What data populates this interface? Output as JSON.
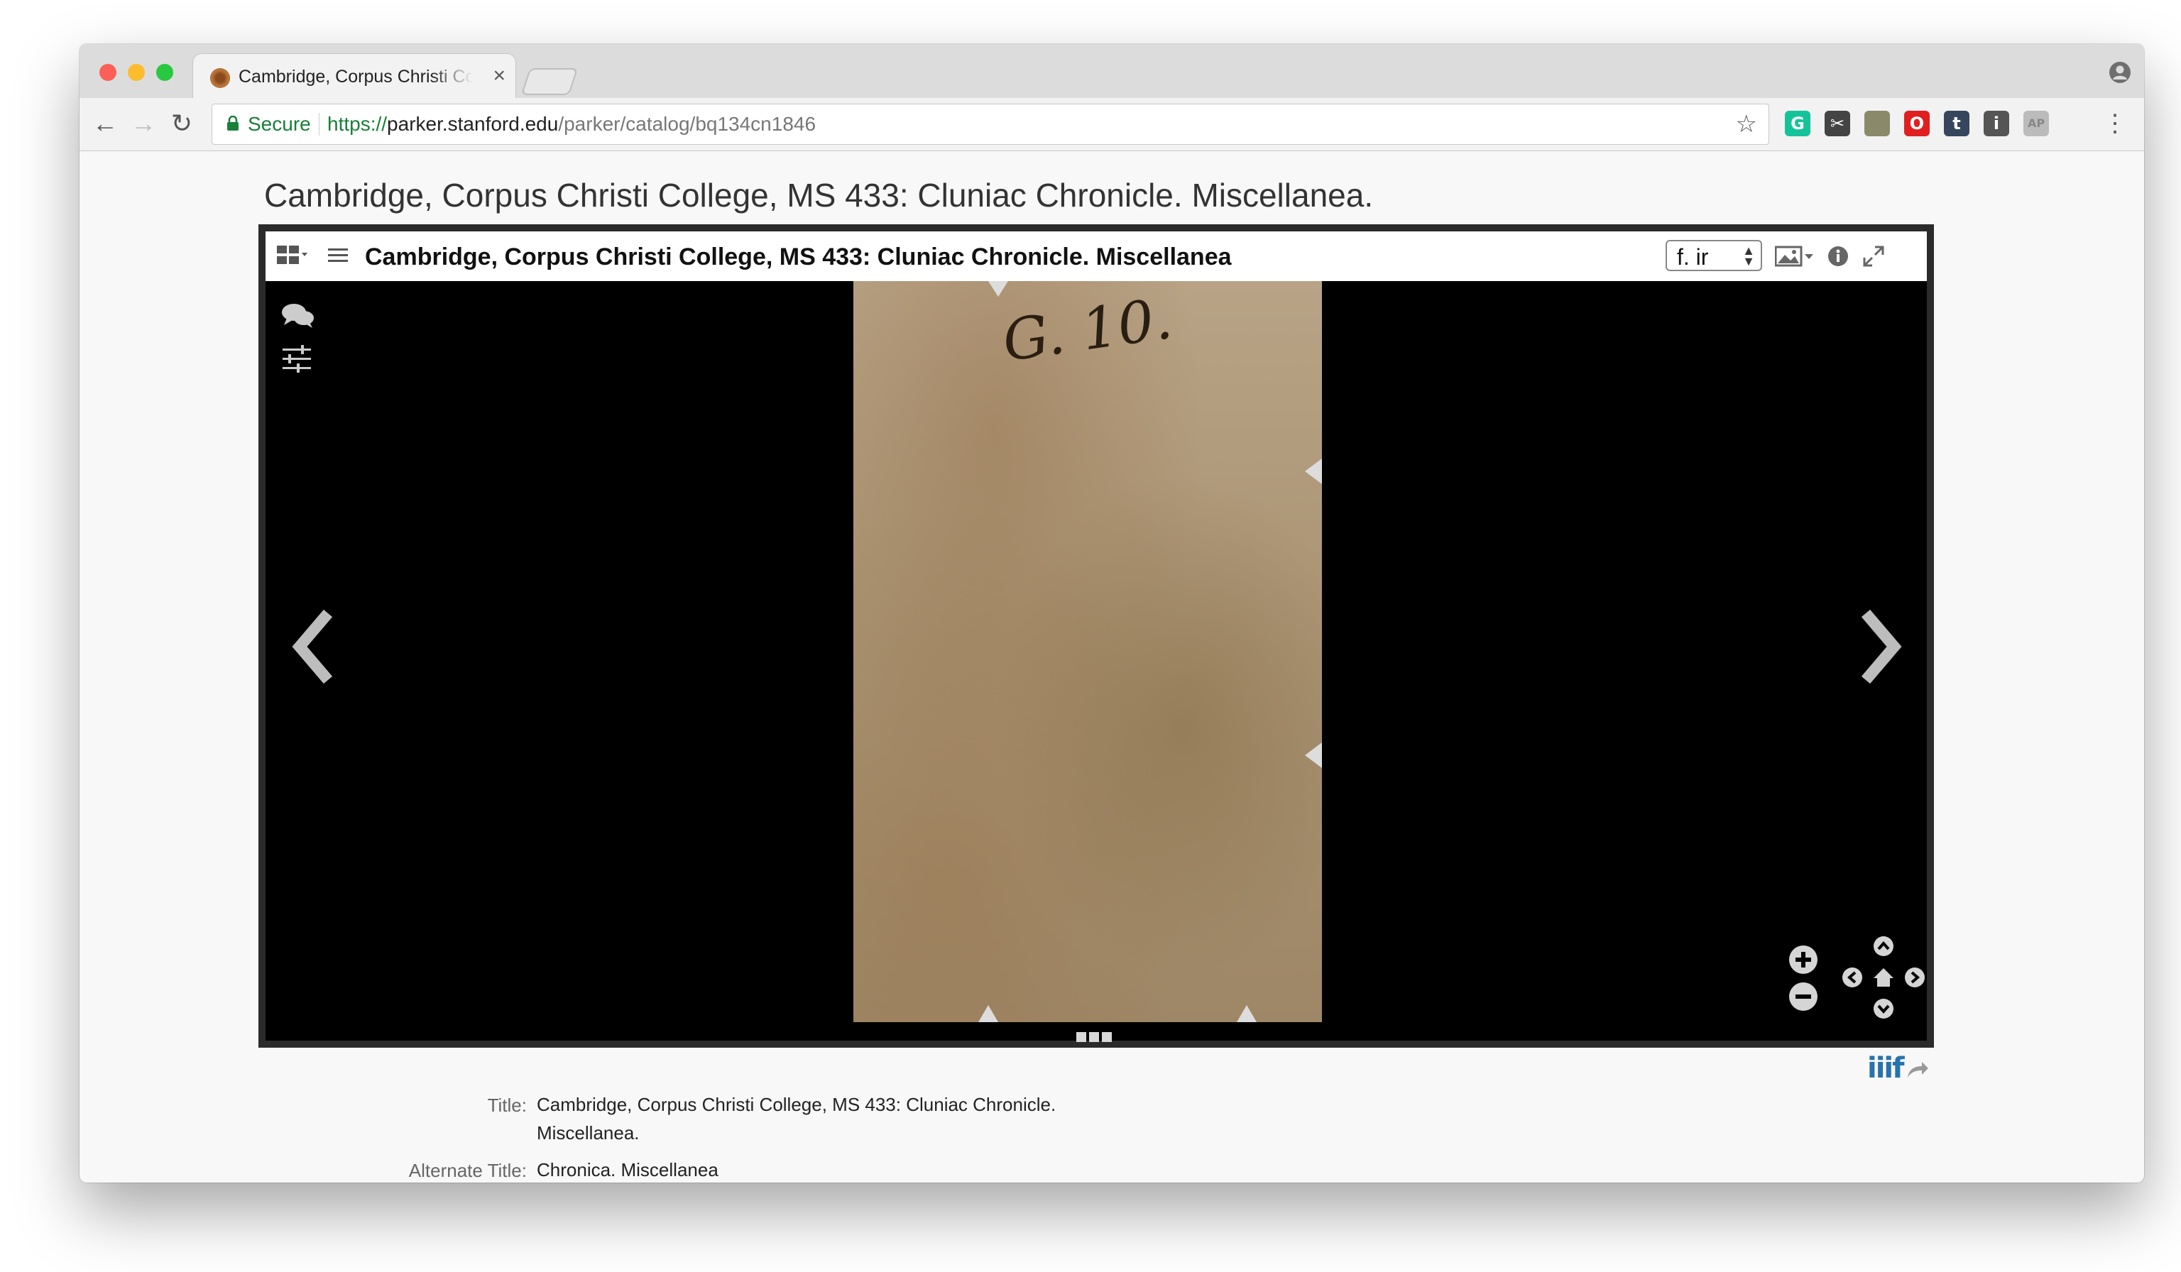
{
  "browser": {
    "tab_title": "Cambridge, Corpus Christi College, MS 433: Cluniac Chronicle. Miscellanea.",
    "tab_close": "×",
    "secure_label": "Secure",
    "url_scheme": "https://",
    "url_host": "parker.stanford.edu",
    "url_path": "/parker/catalog/bq134cn1846",
    "extensions": [
      {
        "icon": "grammarly-icon",
        "color": "#15c39a",
        "glyph": "G"
      },
      {
        "icon": "scissors-icon",
        "color": "#444444",
        "glyph": "✂"
      },
      {
        "icon": "postage-stamp-icon",
        "color": "#8a8a6a",
        "glyph": ""
      },
      {
        "icon": "opera-icon",
        "color": "#e02020",
        "glyph": "O"
      },
      {
        "icon": "tumblr-icon",
        "color": "#36465d",
        "glyph": "t"
      },
      {
        "icon": "onepassword-icon",
        "color": "#555555",
        "glyph": "i"
      },
      {
        "icon": "ap-icon",
        "color": "#bbbbbb",
        "glyph": "AP"
      }
    ]
  },
  "page": {
    "title": "Cambridge, Corpus Christi College, MS 433: Cluniac Chronicle. Miscellanea."
  },
  "viewer": {
    "title": "Cambridge, Corpus Christi College, MS 433: Cluniac Chronicle. Miscellanea",
    "folio_select": "f. ir",
    "shelfmark_text": "G. 10.",
    "icons": [
      "view-grid-icon",
      "hamburger-icon",
      "image-icon",
      "info-icon",
      "fullscreen-icon",
      "comments-icon",
      "sliders-icon",
      "previous-arrow-icon",
      "next-arrow-icon",
      "zoom-in-icon",
      "zoom-out-icon",
      "pan-up-icon",
      "pan-down-icon",
      "pan-left-icon",
      "pan-right-icon",
      "home-icon"
    ]
  },
  "iiif": {
    "label": "iiif"
  },
  "metadata": [
    {
      "label": "Title:",
      "value": "Cambridge, Corpus Christi College, MS 433: Cluniac Chronicle. Miscellanea."
    },
    {
      "label": "Alternate Title:",
      "value": "Chronica. Miscellanea"
    }
  ],
  "colors": {
    "secure_green": "#188038",
    "viewer_bg": "#000000",
    "iiif_blue": "#2873ab",
    "iiif_red": "#ed1d33"
  }
}
